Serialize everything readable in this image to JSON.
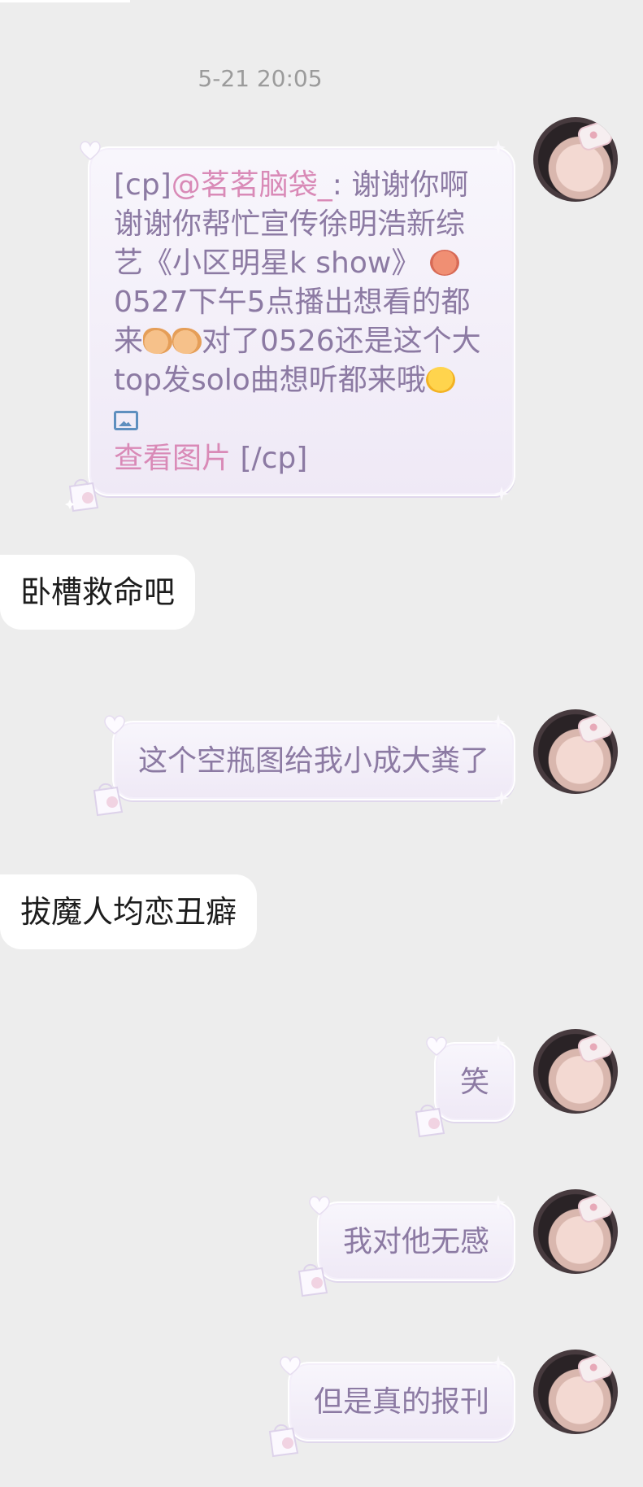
{
  "timestamp": "5-21 20:05",
  "messages": [
    {
      "type": "sent",
      "prefix": "[cp]",
      "mention": "@茗茗脑袋_",
      "text_a": ": 谢谢你啊谢谢你帮忙宣传徐明浩新综艺《小区明星k show》",
      "text_b": "0527下午5点播出想看的都来",
      "text_c": "对了0526还是这个大top发solo曲想听都来哦",
      "link": "查看图片",
      "suffix": " [/cp]"
    },
    {
      "type": "received",
      "text": "卧槽救命吧"
    },
    {
      "type": "sent",
      "text": "这个空瓶图给我小成大粪了"
    },
    {
      "type": "received",
      "text": "拔魔人均恋丑癖"
    },
    {
      "type": "sent",
      "text": "笑"
    },
    {
      "type": "sent",
      "text": "我对他无感"
    },
    {
      "type": "sent",
      "text": "但是真的报刊"
    }
  ],
  "icons": [
    "avatar",
    "monster-emoji",
    "ok-hand-emoji",
    "blush-emoji",
    "image-icon",
    "heart-sticker",
    "bag-sticker"
  ],
  "colors": {
    "background": "#ededed",
    "sent_bubble": "#f3eef9",
    "sent_text": "#8c7aa3",
    "mention": "#d98ab7",
    "received_bubble": "#ffffff",
    "received_text": "#1d1d1d",
    "timestamp": "#9b9b9b"
  }
}
